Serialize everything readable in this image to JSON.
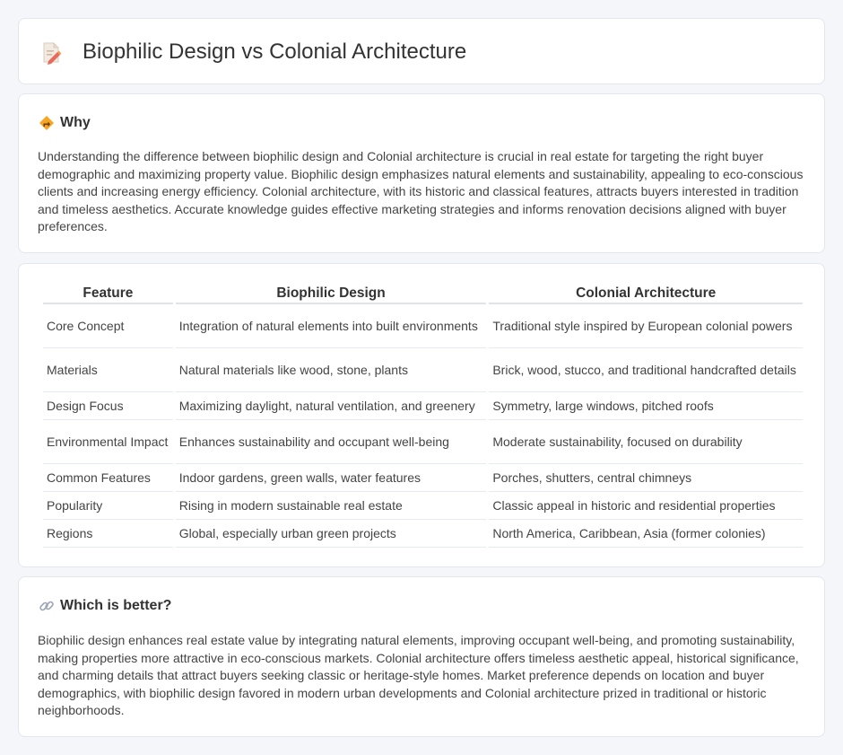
{
  "header": {
    "title": "Biophilic Design vs Colonial Architecture",
    "icon": "document-pen-icon"
  },
  "why": {
    "heading": "Why",
    "icon": "diamond-sign-icon",
    "text": "Understanding the difference between biophilic design and Colonial architecture is crucial in real estate for targeting the right buyer demographic and maximizing property value. Biophilic design emphasizes natural elements and sustainability, appealing to eco-conscious clients and increasing energy efficiency. Colonial architecture, with its historic and classical features, attracts buyers interested in tradition and timeless aesthetics. Accurate knowledge guides effective marketing strategies and informs renovation decisions aligned with buyer preferences."
  },
  "table": {
    "headers": [
      "Feature",
      "Biophilic Design",
      "Colonial Architecture"
    ],
    "rows": [
      [
        "Core Concept",
        "Integration of natural elements into built environments",
        "Traditional style inspired by European colonial powers"
      ],
      [
        "Materials",
        "Natural materials like wood, stone, plants",
        "Brick, wood, stucco, and traditional handcrafted details"
      ],
      [
        "Design Focus",
        "Maximizing daylight, natural ventilation, and greenery",
        "Symmetry, large windows, pitched roofs"
      ],
      [
        "Environmental Impact",
        "Enhances sustainability and occupant well-being",
        "Moderate sustainability, focused on durability"
      ],
      [
        "Common Features",
        "Indoor gardens, green walls, water features",
        "Porches, shutters, central chimneys"
      ],
      [
        "Popularity",
        "Rising in modern sustainable real estate",
        "Classic appeal in historic and residential properties"
      ],
      [
        "Regions",
        "Global, especially urban green projects",
        "North America, Caribbean, Asia (former colonies)"
      ]
    ]
  },
  "better": {
    "heading": "Which is better?",
    "icon": "link-icon",
    "text": "Biophilic design enhances real estate value by integrating natural elements, improving occupant well-being, and promoting sustainability, making properties more attractive in eco-conscious markets. Colonial architecture offers timeless aesthetic appeal, historical significance, and charming details that attract buyers seeking classic or heritage-style homes. Market preference depends on location and buyer demographics, with biophilic design favored in modern urban developments and Colonial architecture prized in traditional or historic neighborhoods."
  }
}
